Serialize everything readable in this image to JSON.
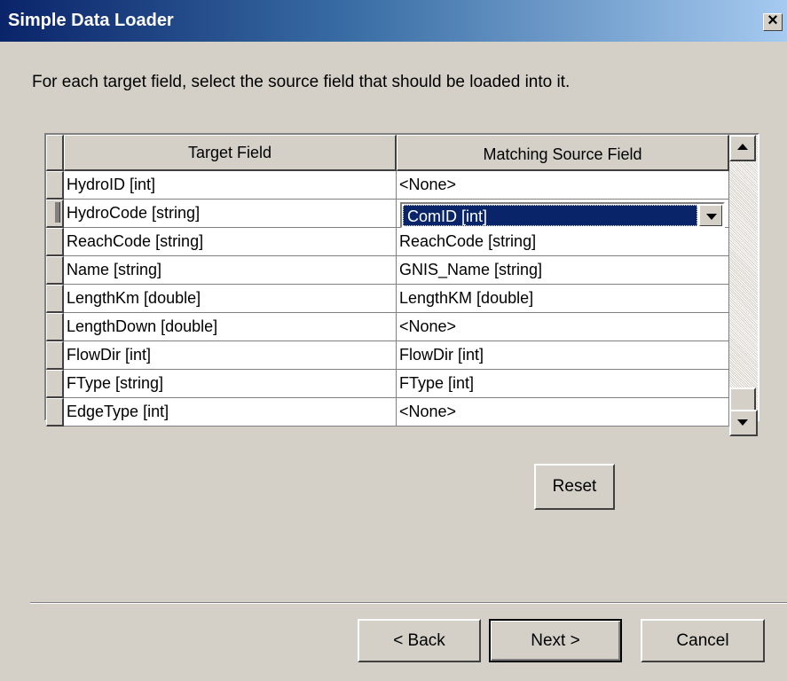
{
  "window": {
    "title": "Simple Data Loader",
    "close_glyph": "×"
  },
  "instructions": "For each target field, select the source field that should be loaded into it.",
  "grid": {
    "columns": [
      "Target Field",
      "Matching Source Field"
    ],
    "rows": [
      {
        "target": "HydroID [int]",
        "source": "<None>"
      },
      {
        "target": "HydroCode [string]",
        "source": "ComID [int]",
        "editing": true
      },
      {
        "target": "ReachCode [string]",
        "source": "ReachCode [string]"
      },
      {
        "target": "Name [string]",
        "source": "GNIS_Name [string]"
      },
      {
        "target": "LengthKm [double]",
        "source": "LengthKM [double]"
      },
      {
        "target": "LengthDown [double]",
        "source": "<None>"
      },
      {
        "target": "FlowDir [int]",
        "source": "FlowDir [int]"
      },
      {
        "target": "FType [string]",
        "source": "FType [int]"
      },
      {
        "target": "EdgeType [int]",
        "source": "<None>"
      }
    ]
  },
  "buttons": {
    "reset": "Reset",
    "back": "< Back",
    "next": "Next >",
    "cancel": "Cancel"
  },
  "colors": {
    "title_start": "#0a246a",
    "title_end": "#a6caf0",
    "face": "#d4d0c8",
    "selection": "#0a246a"
  }
}
